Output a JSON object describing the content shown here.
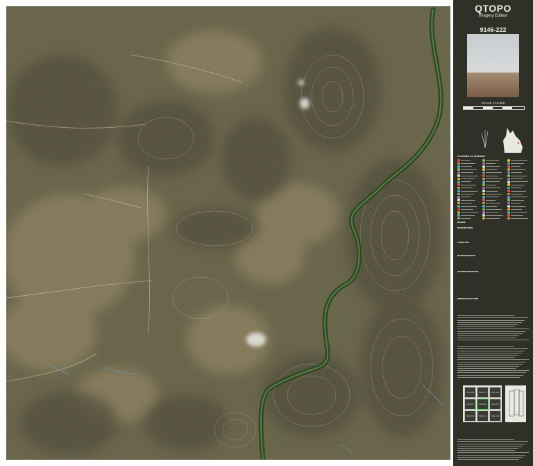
{
  "header": {
    "title": "QTOPO",
    "edition": "Imagery Edition",
    "sheet_number": "9146-222",
    "scale": "SCALE 1:10,000"
  },
  "map": {
    "description_tag": "satellite-imagery-map",
    "colors": {
      "terrain": "#5d5a3f",
      "ridge_shadow": "#3c3b2a",
      "cleared_land": "#8c7b58",
      "creek_vegetation": "#2e4a25",
      "contour": "#d8d4c4",
      "track": "#cfc2a6",
      "watercourse": "#5fa9d6",
      "cloud": "#e8e8e4"
    }
  },
  "panel": {
    "legend_heading": "FEATURES OF INTEREST",
    "sections": [
      "ROADS",
      "BOUNDARIES",
      "LAND USE",
      "HYDROGRAPHY",
      "TRANSPORTATION",
      "INFRASTRUCTURE"
    ],
    "index_cells": [
      "9146-224",
      "9146-223",
      "9146-232",
      "9146-221",
      "9146-222",
      "9146-231",
      "9146-114",
      "9146-113",
      "9146-134"
    ]
  }
}
